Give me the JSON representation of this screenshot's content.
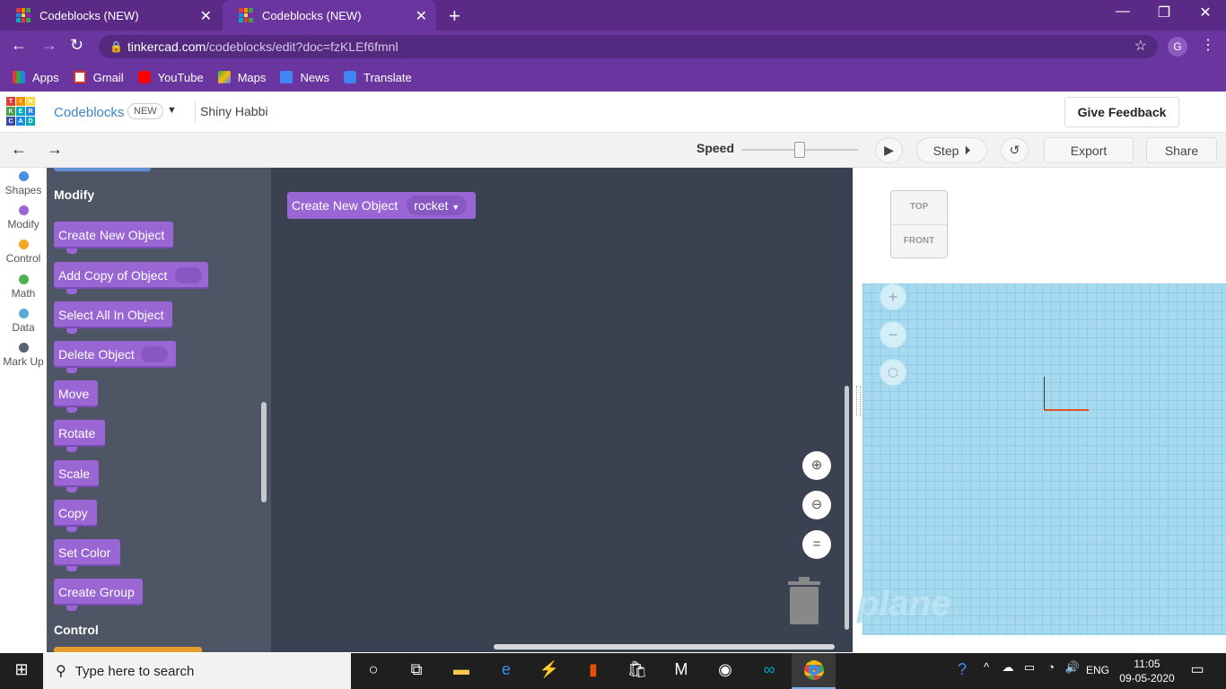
{
  "browser": {
    "tabs": [
      {
        "title": "Codeblocks (NEW)"
      },
      {
        "title": "Codeblocks (NEW)"
      }
    ],
    "new_tab": "+",
    "url_host": "tinkercad.com",
    "url_path": "/codeblocks/edit?doc=fzKLEf6fmnl",
    "profile_initial": "G",
    "bookmarks": [
      "Apps",
      "Gmail",
      "YouTube",
      "Maps",
      "News",
      "Translate"
    ]
  },
  "header": {
    "logo_letters": [
      "T",
      "I",
      "N",
      "K",
      "E",
      "R",
      "C",
      "A",
      "D"
    ],
    "app_name": "Codeblocks",
    "badge": "NEW",
    "project_name": "Shiny Habbi",
    "feedback_label": "Give Feedback"
  },
  "toolbar": {
    "speed_label": "Speed",
    "speed_value": 0.5,
    "step_label": "Step",
    "export_label": "Export",
    "share_label": "Share"
  },
  "categories": [
    {
      "label": "Shapes",
      "color": "#4a90e2"
    },
    {
      "label": "Modify",
      "color": "#9966d4"
    },
    {
      "label": "Control",
      "color": "#f5a623"
    },
    {
      "label": "Math",
      "color": "#4caf50"
    },
    {
      "label": "Data",
      "color": "#5aa9d6"
    },
    {
      "label": "Mark Up",
      "color": "#5a6470"
    }
  ],
  "flyout": {
    "heading": "Modify",
    "blocks": [
      "Create New Object",
      "Add Copy of Object",
      "Select All In Object",
      "Delete Object",
      "Move",
      "Rotate",
      "Scale",
      "Copy",
      "Set Color",
      "Create Group"
    ],
    "next_heading": "Control"
  },
  "workspace": {
    "block_label": "Create New Object",
    "dropdown_value": "rocket"
  },
  "viewport": {
    "cube_top": "TOP",
    "cube_front": "FRONT",
    "plane_label": "plane"
  },
  "taskbar": {
    "search_placeholder": "Type here to search",
    "language": "ENG",
    "time": "11:05",
    "date": "09-05-2020"
  }
}
